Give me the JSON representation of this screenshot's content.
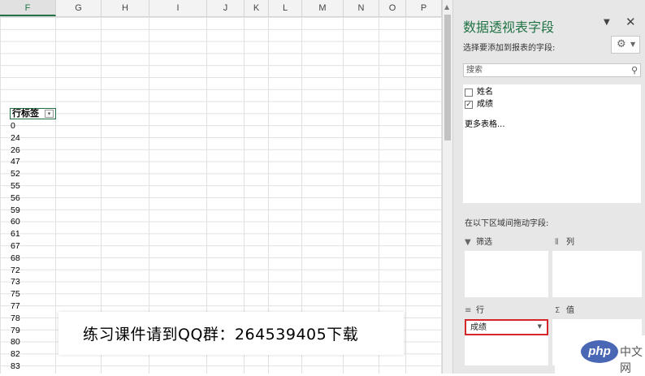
{
  "sheet": {
    "columns": [
      {
        "label": "F",
        "selected": true
      },
      {
        "label": "G"
      },
      {
        "label": "H"
      },
      {
        "label": "I"
      },
      {
        "label": "J"
      },
      {
        "label": "K"
      },
      {
        "label": "L"
      },
      {
        "label": "M"
      },
      {
        "label": "N"
      },
      {
        "label": "O"
      },
      {
        "label": "P"
      }
    ],
    "row_label_header": "行标签",
    "values": [
      "0",
      "24",
      "26",
      "47",
      "52",
      "55",
      "56",
      "59",
      "60",
      "61",
      "67",
      "68",
      "72",
      "73",
      "75",
      "77",
      "78",
      "79",
      "80",
      "82",
      "83"
    ]
  },
  "caption": "练习课件请到QQ群：264539405下载",
  "pivot": {
    "title": "数据透视表字段",
    "subtitle": "选择要添加到报表的字段:",
    "search_placeholder": "搜索",
    "fields": [
      {
        "name": "姓名",
        "checked": false
      },
      {
        "name": "成绩",
        "checked": true
      }
    ],
    "more_tables": "更多表格...",
    "drag_hint": "在以下区域间拖动字段:",
    "areas": {
      "filter": "筛选",
      "columns": "列",
      "rows": "行",
      "values": "值"
    },
    "row_items": [
      "成绩"
    ]
  },
  "watermark": {
    "text": "php",
    "site": "中文网"
  },
  "icons": {
    "search": "search-icon",
    "gear": "gear-icon",
    "filter": "filter-icon",
    "columns": "columns-icon",
    "rows": "rows-icon",
    "sigma": "sigma-icon"
  },
  "colors": {
    "accent": "#217346",
    "highlight": "#d4262b"
  }
}
